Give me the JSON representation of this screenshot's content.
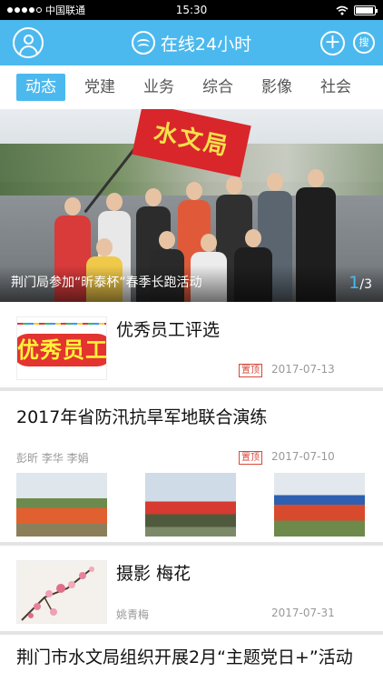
{
  "status_bar": {
    "carrier": "中国联通",
    "time": "15:30",
    "signal_bars": 4,
    "battery_level": 0.95
  },
  "header": {
    "title": "在线24小时",
    "search_label": "搜"
  },
  "tabs": [
    {
      "label": "动态",
      "active": true
    },
    {
      "label": "党建",
      "active": false
    },
    {
      "label": "业务",
      "active": false
    },
    {
      "label": "综合",
      "active": false
    },
    {
      "label": "影像",
      "active": false
    },
    {
      "label": "社会",
      "active": false
    }
  ],
  "banner": {
    "caption": "荆门局参加“昕泰杯”春季长跑活动",
    "flag_text": "水文局",
    "page_current": "1",
    "page_total": "/3"
  },
  "articles": [
    {
      "title": "优秀员工评选",
      "thumb_text": "优秀员工",
      "badge": "置顶",
      "date": "2017-07-13"
    },
    {
      "title": "2017年省防汛抗旱军地联合演练",
      "authors": "彭昕 李华 李娟",
      "badge": "置顶",
      "date": "2017-07-10"
    },
    {
      "title": "摄影 梅花",
      "author": "姚青梅",
      "date": "2017-07-31"
    },
    {
      "title": "荆门市水文局组织开展2月“主题党日+”活动"
    }
  ],
  "colors": {
    "accent": "#4cb9ee",
    "badge_red": "#d9473a",
    "flag_red": "#d9262b"
  }
}
